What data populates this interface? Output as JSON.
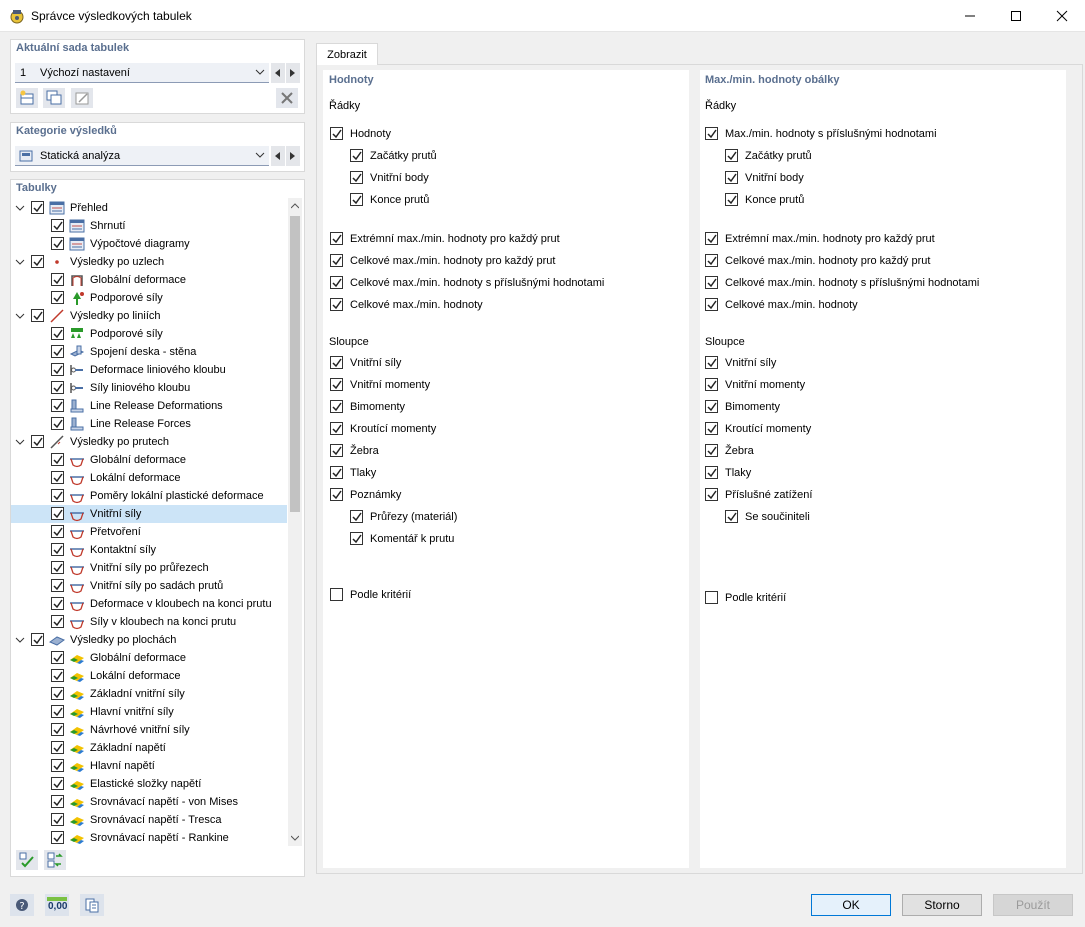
{
  "window": {
    "title": "Správce výsledkových tabulek"
  },
  "table_set": {
    "title": "Aktuální sada tabulek",
    "number": "1",
    "name": "Výchozí nastavení"
  },
  "category": {
    "title": "Kategorie výsledků",
    "name": "Statická analýza"
  },
  "tables": {
    "title": "Tabulky",
    "items": [
      {
        "label": "Přehled",
        "level": 0,
        "icon": "overview-icon"
      },
      {
        "label": "Shrnutí",
        "level": 1,
        "icon": "summary-icon"
      },
      {
        "label": "Výpočtové diagramy",
        "level": 1,
        "icon": "diagram-icon"
      },
      {
        "label": "Výsledky po uzlech",
        "level": 0,
        "icon": "node-icon"
      },
      {
        "label": "Globální deformace",
        "level": 1,
        "icon": "node-deform-icon"
      },
      {
        "label": "Podporové síly",
        "level": 1,
        "icon": "support-icon"
      },
      {
        "label": "Výsledky po liniích",
        "level": 0,
        "icon": "line-icon"
      },
      {
        "label": "Podporové síly",
        "level": 1,
        "icon": "line-support-icon"
      },
      {
        "label": "Spojení deska - stěna",
        "level": 1,
        "icon": "plate-wall-icon"
      },
      {
        "label": "Deformace liniového kloubu",
        "level": 1,
        "icon": "line-hinge-icon"
      },
      {
        "label": "Síly liniového kloubu",
        "level": 1,
        "icon": "line-hinge-icon"
      },
      {
        "label": "Line Release Deformations",
        "level": 1,
        "icon": "line-release-icon"
      },
      {
        "label": "Line Release Forces",
        "level": 1,
        "icon": "line-release-icon"
      },
      {
        "label": "Výsledky po prutech",
        "level": 0,
        "icon": "member-icon"
      },
      {
        "label": "Globální deformace",
        "level": 1,
        "icon": "member-result-icon"
      },
      {
        "label": "Lokální deformace",
        "level": 1,
        "icon": "member-result-icon"
      },
      {
        "label": "Poměry lokální plastické deformace",
        "level": 1,
        "icon": "member-result-icon"
      },
      {
        "label": "Vnitřní síly",
        "level": 1,
        "icon": "member-result-icon",
        "selected": true
      },
      {
        "label": "Přetvoření",
        "level": 1,
        "icon": "member-result-icon"
      },
      {
        "label": "Kontaktní síly",
        "level": 1,
        "icon": "member-result-icon"
      },
      {
        "label": "Vnitřní síly po průřezech",
        "level": 1,
        "icon": "member-result-icon"
      },
      {
        "label": "Vnitřní síly po sadách prutů",
        "level": 1,
        "icon": "member-result-icon"
      },
      {
        "label": "Deformace v kloubech na konci prutu",
        "level": 1,
        "icon": "member-result-icon"
      },
      {
        "label": "Síly v kloubech na konci prutu",
        "level": 1,
        "icon": "member-result-icon"
      },
      {
        "label": "Výsledky po plochách",
        "level": 0,
        "icon": "surface-icon"
      },
      {
        "label": "Globální deformace",
        "level": 1,
        "icon": "surface-result-icon"
      },
      {
        "label": "Lokální deformace",
        "level": 1,
        "icon": "surface-result-icon"
      },
      {
        "label": "Základní vnitřní síly",
        "level": 1,
        "icon": "surface-result-icon"
      },
      {
        "label": "Hlavní vnitřní síly",
        "level": 1,
        "icon": "surface-result-icon"
      },
      {
        "label": "Návrhové vnitřní síly",
        "level": 1,
        "icon": "surface-result-icon"
      },
      {
        "label": "Základní napětí",
        "level": 1,
        "icon": "surface-result-icon"
      },
      {
        "label": "Hlavní napětí",
        "level": 1,
        "icon": "surface-result-icon"
      },
      {
        "label": "Elastické složky napětí",
        "level": 1,
        "icon": "surface-result-icon"
      },
      {
        "label": "Srovnávací napětí - von Mises",
        "level": 1,
        "icon": "surface-result-icon"
      },
      {
        "label": "Srovnávací napětí - Tresca",
        "level": 1,
        "icon": "surface-result-icon"
      },
      {
        "label": "Srovnávací napětí - Rankine",
        "level": 1,
        "icon": "surface-result-icon"
      }
    ]
  },
  "tab": {
    "label": "Zobrazit"
  },
  "left_col": {
    "title": "Hodnoty",
    "rows_label": "Řádky",
    "columns_label": "Sloupce",
    "rows": [
      {
        "label": "Hodnoty",
        "checked": true,
        "indent": 0
      },
      {
        "label": "Začátky prutů",
        "checked": true,
        "indent": 1
      },
      {
        "label": "Vnitřní body",
        "checked": true,
        "indent": 1
      },
      {
        "label": "Konce prutů",
        "checked": true,
        "indent": 1
      },
      {
        "label": "Extrémní max./min. hodnoty pro každý prut",
        "checked": true,
        "indent": 0
      },
      {
        "label": "Celkové max./min. hodnoty pro každý prut",
        "checked": true,
        "indent": 0
      },
      {
        "label": "Celkové max./min. hodnoty s příslušnými hodnotami",
        "checked": true,
        "indent": 0
      },
      {
        "label": "Celkové max./min. hodnoty",
        "checked": true,
        "indent": 0
      }
    ],
    "columns": [
      {
        "label": "Vnitřní síly",
        "checked": true,
        "indent": 0
      },
      {
        "label": "Vnitřní momenty",
        "checked": true,
        "indent": 0
      },
      {
        "label": "Bimomenty",
        "checked": true,
        "indent": 0
      },
      {
        "label": "Kroutící momenty",
        "checked": true,
        "indent": 0
      },
      {
        "label": "Žebra",
        "checked": true,
        "indent": 0
      },
      {
        "label": "Tlaky",
        "checked": true,
        "indent": 0
      },
      {
        "label": "Poznámky",
        "checked": true,
        "indent": 0
      },
      {
        "label": "Průřezy (materiál)",
        "checked": true,
        "indent": 1
      },
      {
        "label": "Komentář k prutu",
        "checked": true,
        "indent": 1
      }
    ],
    "criteria": {
      "label": "Podle kritérií",
      "checked": false
    }
  },
  "right_col": {
    "title": "Max./min. hodnoty obálky",
    "rows_label": "Řádky",
    "columns_label": "Sloupce",
    "rows": [
      {
        "label": "Max./min. hodnoty s příslušnými hodnotami",
        "checked": true,
        "indent": 0
      },
      {
        "label": "Začátky prutů",
        "checked": true,
        "indent": 1
      },
      {
        "label": "Vnitřní body",
        "checked": true,
        "indent": 1
      },
      {
        "label": "Konce prutů",
        "checked": true,
        "indent": 1
      },
      {
        "label": "Extrémní max./min. hodnoty pro každý prut",
        "checked": true,
        "indent": 0
      },
      {
        "label": "Celkové max./min. hodnoty pro každý prut",
        "checked": true,
        "indent": 0
      },
      {
        "label": "Celkové max./min. hodnoty s příslušnými hodnotami",
        "checked": true,
        "indent": 0
      },
      {
        "label": "Celkové max./min. hodnoty",
        "checked": true,
        "indent": 0
      }
    ],
    "columns": [
      {
        "label": "Vnitřní síly",
        "checked": true,
        "indent": 0
      },
      {
        "label": "Vnitřní momenty",
        "checked": true,
        "indent": 0
      },
      {
        "label": "Bimomenty",
        "checked": true,
        "indent": 0
      },
      {
        "label": "Kroutící momenty",
        "checked": true,
        "indent": 0
      },
      {
        "label": "Žebra",
        "checked": true,
        "indent": 0
      },
      {
        "label": "Tlaky",
        "checked": true,
        "indent": 0
      },
      {
        "label": "Příslušné zatížení",
        "checked": true,
        "indent": 0
      },
      {
        "label": "Se součiniteli",
        "checked": true,
        "indent": 1
      }
    ],
    "criteria": {
      "label": "Podle kritérií",
      "checked": false
    }
  },
  "footer": {
    "ok": "OK",
    "cancel": "Storno",
    "apply": "Použít",
    "decimals_label": "0,00"
  },
  "colors": {
    "accent": "#0078d7",
    "section_title": "#5a6f8f",
    "selection": "#cce4f7"
  }
}
